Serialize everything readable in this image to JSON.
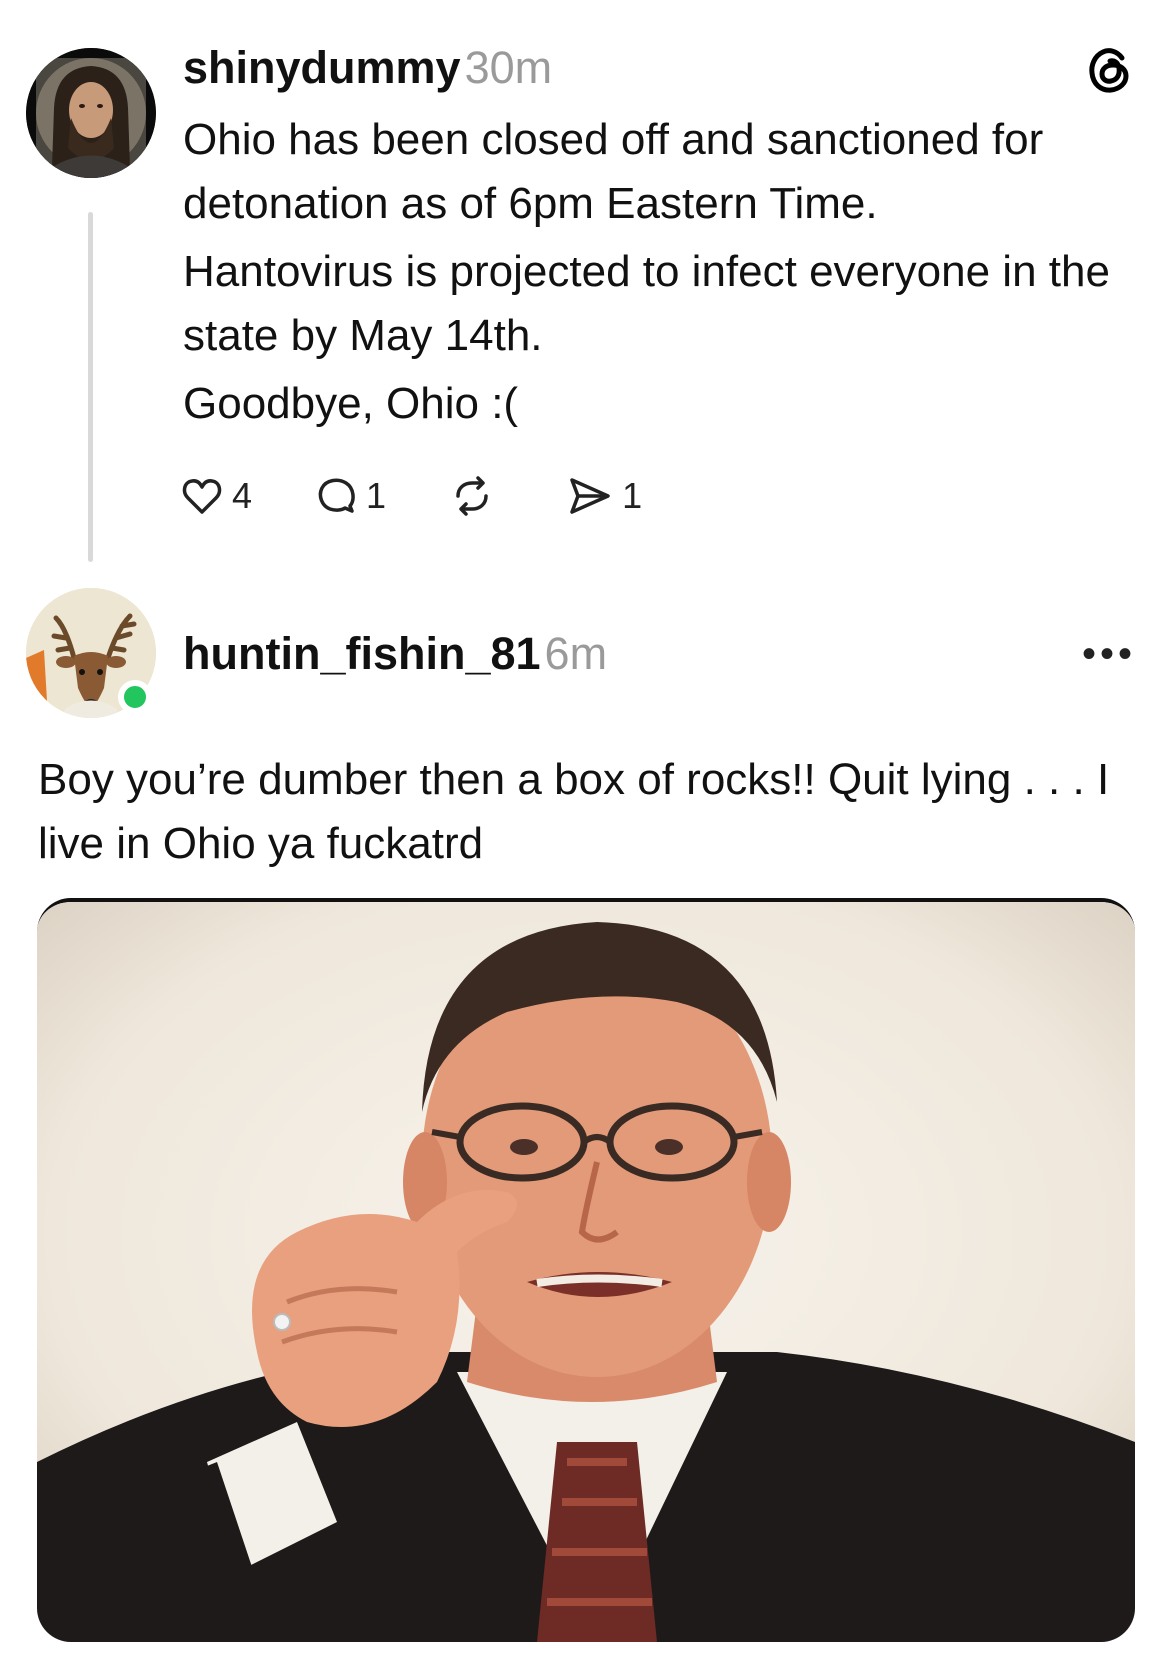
{
  "post": {
    "username": "shinydummy",
    "time": "30m",
    "paragraphs": [
      "Ohio has been closed off and sanctioned for detonation as of 6pm Eastern Time.",
      "Hantovirus is projected to infect everyone in the state by May 14th.",
      "Goodbye, Ohio :("
    ],
    "likes": "4",
    "replies": "1",
    "shares": "1",
    "icons": [
      "threads-logo-icon",
      "heart-icon",
      "comment-icon",
      "repost-icon",
      "send-icon"
    ]
  },
  "reply": {
    "username": "huntin_fishin_81",
    "time": "6m",
    "text": "Boy you’re dumber then a box of rocks!! Quit lying . . . I live in Ohio ya fuckatrd",
    "more": "•••",
    "online_color": "#22c55e"
  }
}
